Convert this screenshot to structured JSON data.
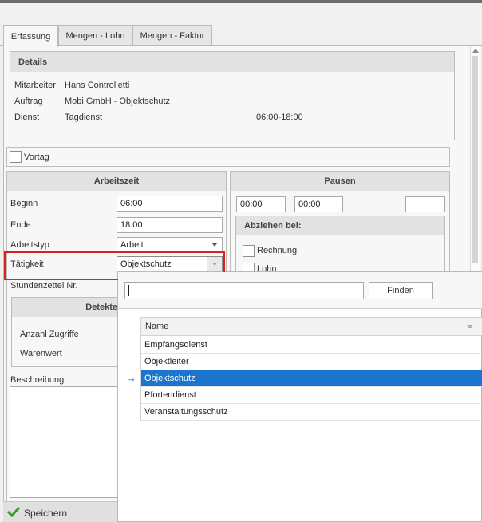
{
  "tabs": [
    "Erfassung",
    "Mengen - Lohn",
    "Mengen - Faktur"
  ],
  "details": {
    "title": "Details",
    "mitarbeiter_label": "Mitarbeiter",
    "mitarbeiter_value": "Hans Controlletti",
    "auftrag_label": "Auftrag",
    "auftrag_value": "Mobi GmbH - Objektschutz",
    "dienst_label": "Dienst",
    "dienst_value": "Tagdienst",
    "dienst_time": "06:00-18:00"
  },
  "vortag_label": "Vortag",
  "arbeitszeit": {
    "title": "Arbeitszeit",
    "beginn_label": "Beginn",
    "beginn_value": "06:00",
    "ende_label": "Ende",
    "ende_value": "18:00",
    "arbeitstyp_label": "Arbeitstyp",
    "arbeitstyp_value": "Arbeit",
    "taetigkeit_label": "Tätigkeit",
    "taetigkeit_value": "Objektschutz",
    "stundenzettel_label": "Stundenzettel Nr."
  },
  "pausen": {
    "title": "Pausen",
    "start": "00:00",
    "end": "00:00",
    "extra": "",
    "abziehen_title": "Abziehen bei:",
    "rechnung_label": "Rechnung",
    "lohn_label": "Lohn"
  },
  "detekt": {
    "title": "Detekte",
    "zugriffe_label": "Anzahl Zugriffe",
    "warenwert_label": "Warenwert"
  },
  "beschreibung_label": "Beschreibung",
  "save_label": "Speichern",
  "popup": {
    "search_value": "",
    "find_label": "Finden",
    "column_name": "Name",
    "items": [
      "Empfangsdienst",
      "Objektleiter",
      "Objektschutz",
      "Pfortendienst",
      "Veranstaltungsschutz"
    ],
    "selected_item": "Objektschutz"
  },
  "colors": {
    "selection": "#1a75cf",
    "highlight_border": "#d9221c",
    "arrow": "#1a75cf",
    "save_check": "#3c9a2e"
  }
}
